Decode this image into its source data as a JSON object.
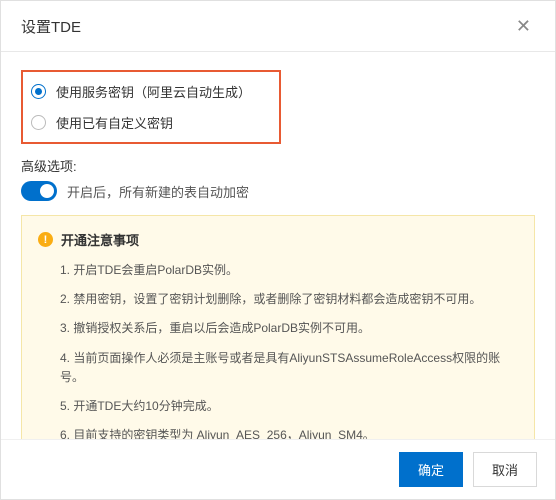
{
  "header": {
    "title": "设置TDE"
  },
  "key_options": {
    "option1": "使用服务密钥（阿里云自动生成）",
    "option2": "使用已有自定义密钥"
  },
  "advanced": {
    "label": "高级选项:",
    "toggle_text": "开启后，所有新建的表自动加密"
  },
  "notice": {
    "title": "开通注意事项",
    "items": {
      "i1": "1. 开启TDE会重启PolarDB实例。",
      "i2": "2. 禁用密钥，设置了密钥计划删除，或者删除了密钥材料都会造成密钥不可用。",
      "i3": "3. 撤销授权关系后，重启以后会造成PolarDB实例不可用。",
      "i4": "4. 当前页面操作人必须是主账号或者是具有AliyunSTSAssumeRoleAccess权限的账号。",
      "i5": "5. 开通TDE大约10分钟完成。",
      "i6": "6. 目前支持的密钥类型为 Aliyun_AES_256，Aliyun_SM4。"
    }
  },
  "footer": {
    "confirm": "确定",
    "cancel": "取消"
  }
}
